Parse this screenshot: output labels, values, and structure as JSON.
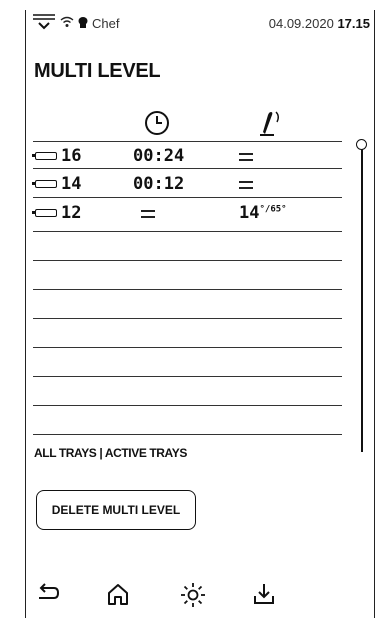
{
  "status": {
    "user": "Chef",
    "date": "04.09.2020",
    "time": "17.15",
    "icons": [
      "menu-icon",
      "wifi-icon",
      "user-icon"
    ]
  },
  "page": {
    "title": "MULTI LEVEL"
  },
  "columns": {
    "time_icon": "clock-icon",
    "probe_icon": "core-probe-icon"
  },
  "rows": [
    {
      "level": "16",
      "time": "00:24",
      "probe": "--",
      "probe_sup": ""
    },
    {
      "level": "14",
      "time": "00:12",
      "probe": "--",
      "probe_sup": ""
    },
    {
      "level": "12",
      "time": "--",
      "probe": "14",
      "probe_sup": "°/65°"
    }
  ],
  "filters": {
    "all": "ALL TRAYS",
    "sep": "|",
    "active": "ACTIVE TRAYS"
  },
  "buttons": {
    "delete": "DELETE MULTI LEVEL"
  },
  "bottom_bar": [
    "back-icon",
    "home-icon",
    "light-icon",
    "download-icon"
  ]
}
